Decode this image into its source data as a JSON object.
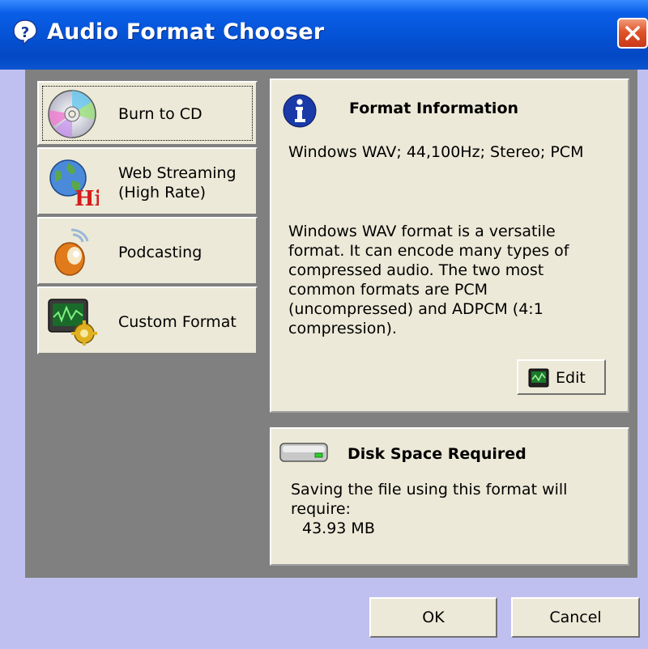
{
  "window": {
    "title": "Audio Format Chooser",
    "title_icon": "help-question-icon",
    "close_icon": "close-icon"
  },
  "presets": [
    {
      "label": "Burn to CD",
      "icon": "cd-disc-icon",
      "focused": true
    },
    {
      "label_line1": "Web Streaming",
      "label_line2": "(High Rate)",
      "icon": "globe-hi-icon"
    },
    {
      "label": "Podcasting",
      "icon": "podcast-icon"
    },
    {
      "label": "Custom Format",
      "icon": "custom-format-icon"
    }
  ],
  "format_info": {
    "title": "Format Information",
    "icon": "info-icon",
    "summary": "Windows WAV; 44,100Hz; Stereo; PCM",
    "description_lines": [
      "Windows WAV format is a versatile",
      "format.  It can encode many types of",
      "compressed audio.  The two most",
      "common formats are PCM",
      "(uncompressed) and ADPCM (4:1",
      "compression)."
    ],
    "edit_label": "Edit",
    "edit_icon": "waveform-monitor-icon"
  },
  "disk_space": {
    "title": "Disk Space Required",
    "icon": "hard-drive-icon",
    "text_line1": "Saving the file using this format will",
    "text_line2": "require:",
    "size": "43.93 MB"
  },
  "buttons": {
    "ok": "OK",
    "cancel": "Cancel"
  },
  "colors": {
    "titlebar": "#0553d6",
    "dialog_bg": "#c0c0f0",
    "panel_bg": "#ece9d8",
    "client_bg": "#808080",
    "close_button": "#e0542a"
  }
}
